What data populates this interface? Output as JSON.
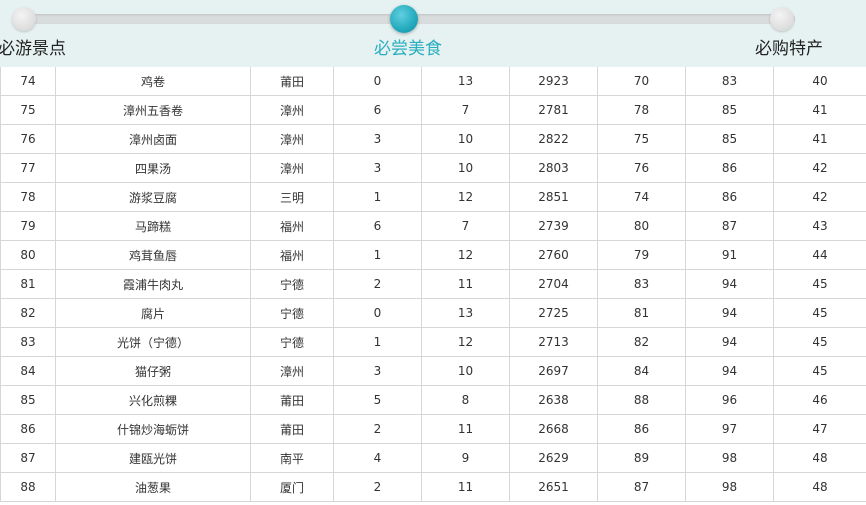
{
  "tabs": [
    {
      "label": "必游景点",
      "active": false
    },
    {
      "label": "必尝美食",
      "active": true
    },
    {
      "label": "必购特产",
      "active": false
    }
  ],
  "colors": {
    "accent": "#2aaec0",
    "header_bg": "#e6f2f1",
    "border": "#d6d6d6"
  },
  "table": {
    "rows": [
      [
        "74",
        "鸡卷",
        "莆田",
        "0",
        "13",
        "2923",
        "70",
        "83",
        "40"
      ],
      [
        "75",
        "漳州五香卷",
        "漳州",
        "6",
        "7",
        "2781",
        "78",
        "85",
        "41"
      ],
      [
        "76",
        "漳州卤面",
        "漳州",
        "3",
        "10",
        "2822",
        "75",
        "85",
        "41"
      ],
      [
        "77",
        "四果汤",
        "漳州",
        "3",
        "10",
        "2803",
        "76",
        "86",
        "42"
      ],
      [
        "78",
        "游浆豆腐",
        "三明",
        "1",
        "12",
        "2851",
        "74",
        "86",
        "42"
      ],
      [
        "79",
        "马蹄糕",
        "福州",
        "6",
        "7",
        "2739",
        "80",
        "87",
        "43"
      ],
      [
        "80",
        "鸡茸鱼唇",
        "福州",
        "1",
        "12",
        "2760",
        "79",
        "91",
        "44"
      ],
      [
        "81",
        "霞浦牛肉丸",
        "宁德",
        "2",
        "11",
        "2704",
        "83",
        "94",
        "45"
      ],
      [
        "82",
        "腐片",
        "宁德",
        "0",
        "13",
        "2725",
        "81",
        "94",
        "45"
      ],
      [
        "83",
        "光饼（宁德）",
        "宁德",
        "1",
        "12",
        "2713",
        "82",
        "94",
        "45"
      ],
      [
        "84",
        "猫仔粥",
        "漳州",
        "3",
        "10",
        "2697",
        "84",
        "94",
        "45"
      ],
      [
        "85",
        "兴化煎粿",
        "莆田",
        "5",
        "8",
        "2638",
        "88",
        "96",
        "46"
      ],
      [
        "86",
        "什锦炒海蛎饼",
        "莆田",
        "2",
        "11",
        "2668",
        "86",
        "97",
        "47"
      ],
      [
        "87",
        "建瓯光饼",
        "南平",
        "4",
        "9",
        "2629",
        "89",
        "98",
        "48"
      ],
      [
        "88",
        "油葱果",
        "厦门",
        "2",
        "11",
        "2651",
        "87",
        "98",
        "48"
      ]
    ]
  }
}
